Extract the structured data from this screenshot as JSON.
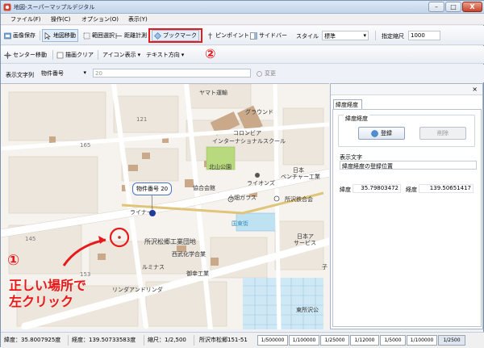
{
  "window": {
    "title": "地図-スーパーマップルデジタル",
    "controls": [
      "–",
      "□",
      "X"
    ]
  },
  "menu": [
    {
      "label": "ファイル(F)"
    },
    {
      "label": "操作(C)"
    },
    {
      "label": "オプション(O)"
    },
    {
      "label": "表示(Y)"
    }
  ],
  "toolbar1": {
    "save": "画像保存",
    "move": "地図移動",
    "select": "範囲選択",
    "measure": "距離計測",
    "bookmark": "ブックマーク",
    "pinpoint": "ピンポイント",
    "sidebar": "サイドバー",
    "style_label": "スタイル",
    "style_value": "標準",
    "scale_label": "指定縮尺",
    "scale_value": "1000"
  },
  "toolbar2": {
    "center": "センター移動",
    "clear": "描画クリア",
    "icon_display": "アイコン表示",
    "text_direction": "テキスト方向"
  },
  "toolbar3": {
    "display_label": "表示文字列",
    "display_value": "物件番号",
    "field_value": "20",
    "change_button": "変更"
  },
  "annotations": {
    "num1": "①",
    "num2": "②",
    "instruction_line1": "正しい場所で",
    "instruction_line2": "左クリック"
  },
  "map": {
    "callout": "物件番号 20",
    "labels": [
      "ヤマト運輸",
      "グラウンド",
      "コロンビア",
      "インターナショナルスクール",
      "北山公園",
      "日本",
      "ベンチャー工業",
      "ライオンズ",
      "協合会館",
      "小畑ガラス",
      "所沢鉄合会",
      "ライナー",
      "国東街",
      "所沢松郷工業団地",
      "西武化学合業",
      "ルミナス",
      "御幸工業",
      "リンダアンドリンダ",
      "日本ア",
      "サービス",
      "東所沢公",
      "145",
      "165",
      "121",
      "153",
      "子"
    ]
  },
  "panel": {
    "tab": "緯度経度",
    "close": "×",
    "group": "緯度経度",
    "register": "登録",
    "delete": "削除",
    "display_text_label": "表示文字",
    "display_text_value": "緯度経度の登録位置",
    "lat_label": "緯度",
    "lat_value": "35.79803472",
    "lon_label": "経度",
    "lon_value": "139.50651417"
  },
  "status": {
    "lat": "緯度：35.8007925度",
    "lon": "経度：139.50733583度",
    "scale": "縮尺：1/2,500",
    "address": "所沢市松郷151-51",
    "scales": [
      "1/500000",
      "1/100000",
      "1/25000",
      "1/12000",
      "1/5000",
      "1/100000",
      "1/2500"
    ]
  },
  "colors": {
    "highlight_red": "#e8191b",
    "callout_border": "#4a73c9"
  }
}
